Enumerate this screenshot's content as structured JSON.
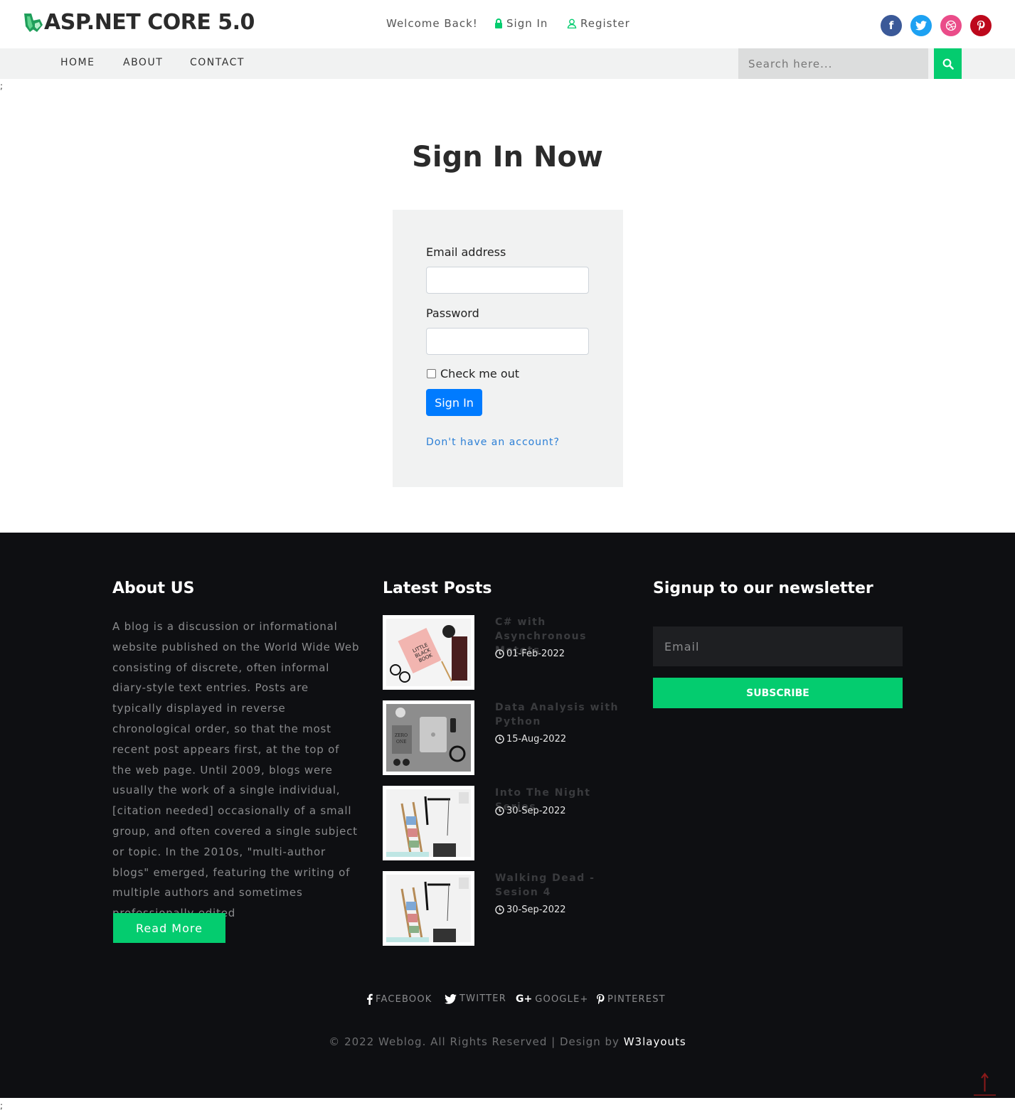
{
  "header": {
    "logo_text": "ASP.NET CORE 5.0",
    "welcome": "Welcome Back!",
    "signin": "Sign In",
    "register": "Register",
    "socials": [
      {
        "icon": "facebook-icon",
        "glyph": "f",
        "color": "#3b5998"
      },
      {
        "icon": "twitter-icon",
        "glyph": "t",
        "color": "#1da1f2"
      },
      {
        "icon": "dribbble-icon",
        "glyph": "◎",
        "color": "#ea4c89"
      },
      {
        "icon": "pinterest-icon",
        "glyph": "p",
        "color": "#bd081c"
      }
    ]
  },
  "nav": {
    "items": [
      "HOME",
      "ABOUT",
      "CONTACT"
    ],
    "search_placeholder": "Search here..."
  },
  "stray_text": ";",
  "main": {
    "title": "Sign In Now",
    "email_label": "Email address",
    "email_value": "",
    "password_label": "Password",
    "password_value": "",
    "check_label": "Check me out",
    "submit": "Sign In",
    "no_account": "Don't have an account?"
  },
  "footer": {
    "about_heading": "About US",
    "about_text": "A blog is a discussion or informational website published on the World Wide Web consisting of discrete, often informal diary-style text entries. Posts are typically displayed in reverse chronological order, so that the most recent post appears first, at the top of the web page. Until 2009, blogs were usually the work of a single individual,[citation needed] occasionally of a small group, and often covered a single subject or topic. In the 2010s, \"multi-author blogs\" emerged, featuring the writing of multiple authors and sometimes professionally edited",
    "read_more": "Read More",
    "posts_heading": "Latest Posts",
    "posts": [
      {
        "title": "C# with Asynchronous Metots",
        "date": "01-Feb-2022"
      },
      {
        "title": "Data Analysis with Python",
        "date": "15-Aug-2022"
      },
      {
        "title": "Into The Night Series",
        "date": "30-Sep-2022"
      },
      {
        "title": "Walking Dead - Sesion 4",
        "date": "30-Sep-2022"
      }
    ],
    "newsletter_heading": "Signup to our newsletter",
    "email_placeholder": "Email",
    "subscribe": "SUBSCRIBE",
    "social_links": [
      "FACEBOOK",
      "TWITTER",
      "GOOGLE+",
      "PINTEREST"
    ],
    "copyright_prefix": "© 2022 Weblog. All Rights Reserved | Design by",
    "copyright_link": "W3layouts"
  },
  "colors": {
    "accent": "#04cc6f",
    "primary_button": "#007bff",
    "footer_bg": "#0e0f12"
  }
}
